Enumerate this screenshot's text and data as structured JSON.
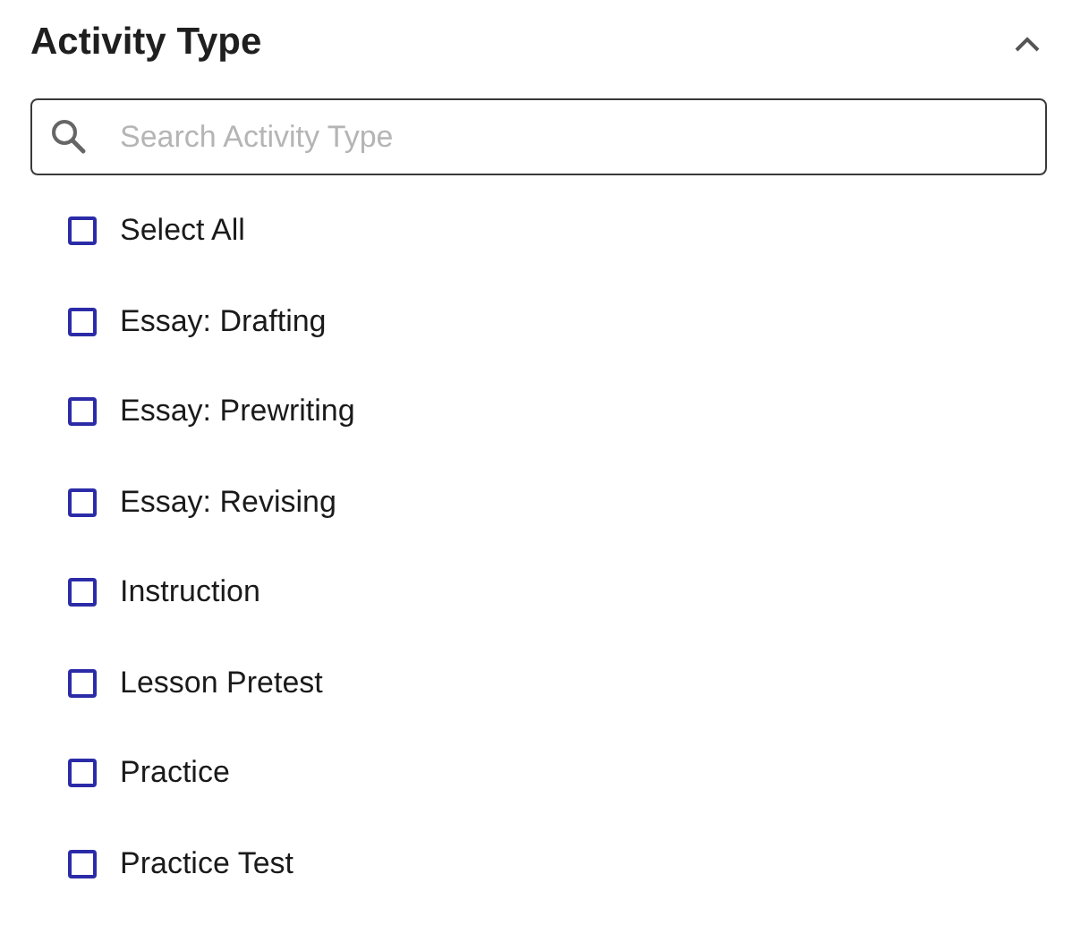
{
  "filter": {
    "title": "Activity Type",
    "expanded": true
  },
  "search": {
    "placeholder": "Search Activity Type"
  },
  "options": [
    {
      "label": "Select All",
      "checked": false
    },
    {
      "label": "Essay: Drafting",
      "checked": false
    },
    {
      "label": "Essay: Prewriting",
      "checked": false
    },
    {
      "label": "Essay: Revising",
      "checked": false
    },
    {
      "label": "Instruction",
      "checked": false
    },
    {
      "label": "Lesson Pretest",
      "checked": false
    },
    {
      "label": "Practice",
      "checked": false
    },
    {
      "label": "Practice Test",
      "checked": false
    }
  ]
}
